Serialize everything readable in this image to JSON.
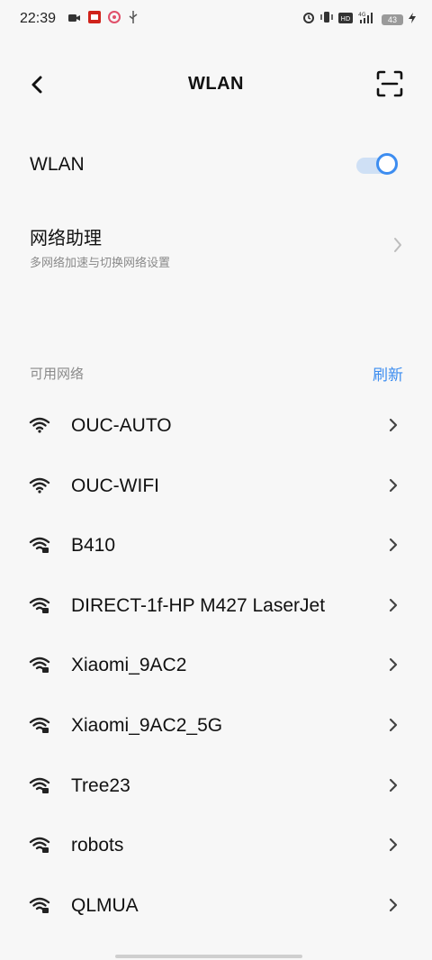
{
  "status_bar": {
    "time": "22:39",
    "network": "4G",
    "battery": "43",
    "hd": "HD"
  },
  "header": {
    "title": "WLAN"
  },
  "wlan_toggle": {
    "label": "WLAN",
    "on": true,
    "accent": "#3d8df0"
  },
  "assistant": {
    "title": "网络助理",
    "subtitle": "多网络加速与切换网络设置"
  },
  "section": {
    "label": "可用网络",
    "refresh_label": "刷新"
  },
  "networks": [
    {
      "ssid": "OUC-AUTO"
    },
    {
      "ssid": "OUC-WIFI"
    },
    {
      "ssid": "B410"
    },
    {
      "ssid": "DIRECT-1f-HP M427 LaserJet"
    },
    {
      "ssid": "Xiaomi_9AC2"
    },
    {
      "ssid": "Xiaomi_9AC2_5G"
    },
    {
      "ssid": "Tree23"
    },
    {
      "ssid": "robots"
    },
    {
      "ssid": "QLMUA"
    }
  ]
}
